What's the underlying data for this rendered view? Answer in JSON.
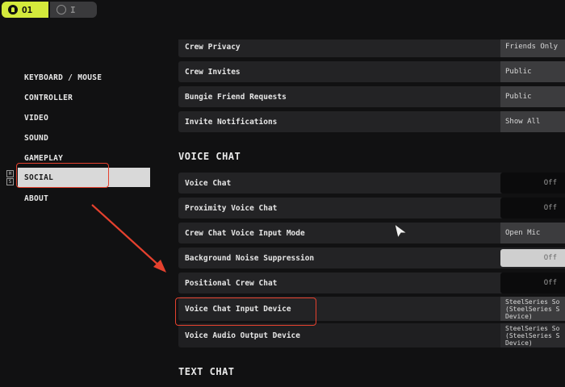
{
  "player_tabs": [
    {
      "label": "O1",
      "active": true,
      "icon": "player-icon"
    },
    {
      "label": "I",
      "active": false,
      "icon": "player-ring-icon"
    }
  ],
  "sidebar": {
    "items": [
      {
        "label": "KEYBOARD / MOUSE",
        "selected": false
      },
      {
        "label": "CONTROLLER",
        "selected": false
      },
      {
        "label": "VIDEO",
        "selected": false
      },
      {
        "label": "SOUND",
        "selected": false
      },
      {
        "label": "GAMEPLAY",
        "selected": false
      },
      {
        "label": "SOCIAL",
        "selected": true
      },
      {
        "label": "ABOUT",
        "selected": false
      }
    ],
    "key_hints": [
      "H",
      "S"
    ]
  },
  "privacy": {
    "rows": [
      {
        "label": "Crew Privacy",
        "value": "Friends Only"
      },
      {
        "label": "Crew Invites",
        "value": "Public"
      },
      {
        "label": "Bungie Friend Requests",
        "value": "Public"
      },
      {
        "label": "Invite Notifications",
        "value": "Show All"
      }
    ]
  },
  "voice_chat": {
    "title": "VOICE CHAT",
    "rows": [
      {
        "label": "Voice Chat",
        "value": "Off"
      },
      {
        "label": "Proximity Voice Chat",
        "value": "Off"
      },
      {
        "label": "Crew Chat Voice Input Mode",
        "value": "Open Mic"
      },
      {
        "label": "Background Noise Suppression",
        "value": "Off"
      },
      {
        "label": "Positional Crew Chat",
        "value": "Off"
      },
      {
        "label": "Voice Chat Input Device",
        "value": "SteelSeries So\n(SteelSeries S\nDevice)"
      },
      {
        "label": "Voice Audio Output Device",
        "value": "SteelSeries So\n(SteelSeries S\nDevice)"
      }
    ]
  },
  "text_chat": {
    "title": "TEXT CHAT"
  },
  "colors": {
    "accent": "#d4ea3c",
    "annotation": "#e5412e",
    "selected_bg": "#d9d9d9"
  }
}
